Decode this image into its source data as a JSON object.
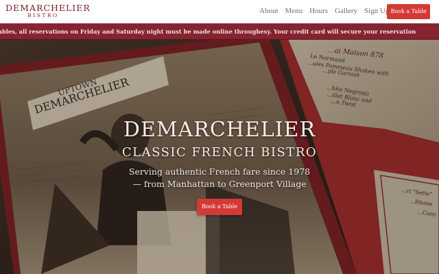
{
  "brand": {
    "name": "DEMARCHELIER",
    "sub": "BISTRO",
    "accent": "#7d1a24"
  },
  "nav": {
    "items": [
      {
        "label": "About"
      },
      {
        "label": "Menu"
      },
      {
        "label": "Hours"
      },
      {
        "label": "Gallery"
      },
      {
        "label": "Sign Up"
      }
    ],
    "book_label": "Book a Table",
    "book_color": "#d33a35"
  },
  "announcement": {
    "text": "lows and the limited number of tables, all reservations on Friday and Saturday night must be made online throughesy. Your credit card will secure your reservation",
    "background": "#862330"
  },
  "hero": {
    "title": "DEMARCHELIER",
    "subtitle": "CLASSIC FRENCH BISTRO",
    "line1": "Serving authentic French fare since 1978",
    "line2": "— from Manhattan to Greenport Village",
    "cta_label": "Book a Table",
    "art": {
      "sign_line1": "UPTOWN",
      "sign_line2": "DEMARCHELIER",
      "menu_heading": "...ai Maison 878",
      "menu_lines": [
        "Le Normand",
        "...ules Pommeau Shaken with",
        "...ple Garnish",
        "...hite Negroni)",
        "...illet Blanc and",
        "...n Twist"
      ],
      "card_lines": [
        "...ri \"Sette\"",
        "...Rhone",
        "...Corn"
      ]
    }
  }
}
